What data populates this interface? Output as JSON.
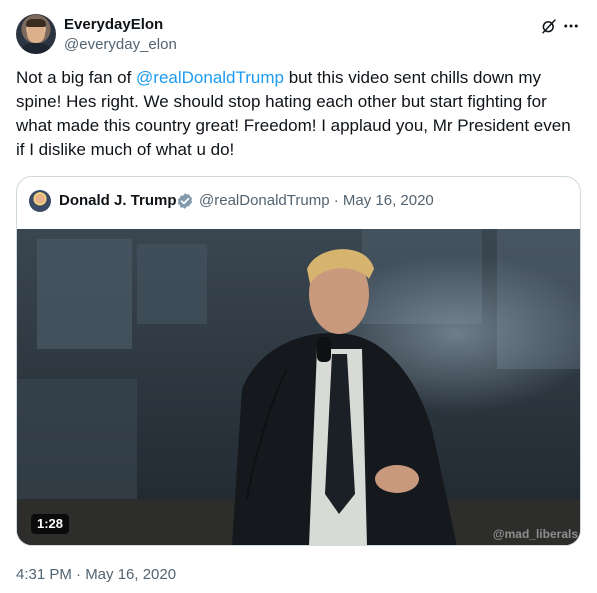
{
  "author": {
    "display_name": "EverydayElon",
    "handle": "@everyday_elon"
  },
  "icons": {
    "header_actions": [
      "grok-icon",
      "more-icon"
    ],
    "verified": "verified-badge-icon"
  },
  "tweet": {
    "text_before": "Not a big fan of ",
    "mention": "@realDonaldTrump",
    "text_after": " but this video sent chills down my spine! Hes right. We should stop hating each other but start fighting for what made this country great! Freedom! I applaud you, Mr President even if I dislike much of what u do!",
    "timestamp": "4:31 PM · May 16, 2020"
  },
  "quoted_tweet": {
    "display_name": "Donald J. Trump",
    "handle_and_date": "@realDonaldTrump · May 16, 2020",
    "video": {
      "duration": "1:28",
      "watermark": "@mad_liberals"
    }
  },
  "colors": {
    "link": "#1d9bf0",
    "secondary_text": "#536471",
    "border": "#cfd9de",
    "verified": "#829aab"
  }
}
